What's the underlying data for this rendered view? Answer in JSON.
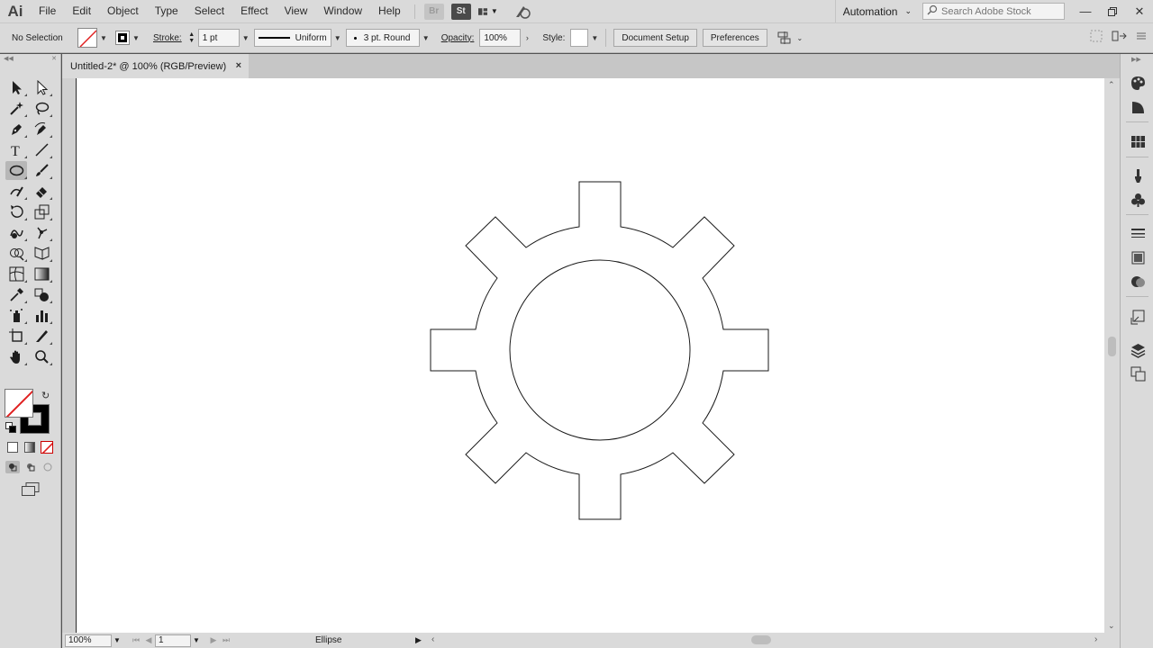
{
  "app": {
    "logo": "Ai",
    "menu": [
      "File",
      "Edit",
      "Object",
      "Type",
      "Select",
      "Effect",
      "View",
      "Window",
      "Help"
    ],
    "bridge_label": "Br",
    "stock_label": "St",
    "workspace": "Automation",
    "search_placeholder": "Search Adobe Stock"
  },
  "control_bar": {
    "selection": "No Selection",
    "stroke_label": "Stroke:",
    "stroke_weight": "1 pt",
    "stroke_profile": "Uniform",
    "brush": "3 pt. Round",
    "opacity_label": "Opacity:",
    "opacity": "100%",
    "style_label": "Style:",
    "document_setup": "Document Setup",
    "preferences": "Preferences"
  },
  "document": {
    "tab_title": "Untitled-2* @ 100% (RGB/Preview)",
    "close_glyph": "×"
  },
  "status_bar": {
    "zoom": "100%",
    "page": "1",
    "current_tool": "Ellipse"
  },
  "colors": {
    "chrome": "#dadada",
    "canvas": "#ffffff",
    "no_fill_slash": "#e02020",
    "stroke_default": "#000000"
  },
  "icons": {
    "toolbar": [
      "selection-tool-icon",
      "direct-selection-tool-icon",
      "magic-wand-icon",
      "lasso-icon",
      "pen-tool-icon",
      "curvature-tool-icon",
      "type-tool-icon",
      "line-segment-icon",
      "ellipse-tool-icon",
      "paintbrush-icon",
      "shaper-tool-icon",
      "eraser-icon",
      "rotate-tool-icon",
      "scale-tool-icon",
      "warp-tool-icon",
      "puppet-warp-icon",
      "shape-builder-icon",
      "perspective-grid-icon",
      "mesh-tool-icon",
      "gradient-tool-icon",
      "eyedropper-icon",
      "blend-tool-icon",
      "symbol-sprayer-icon",
      "column-graph-icon",
      "artboard-tool-icon",
      "slice-tool-icon",
      "hand-tool-icon",
      "zoom-tool-icon"
    ],
    "dock": [
      "color-guide-icon",
      "gradient-panel-icon",
      "swatches-icon",
      "brushes-icon",
      "symbols-icon",
      "stroke-panel-icon",
      "gradient-swatch-icon",
      "transparency-icon",
      "asset-export-icon",
      "layers-icon",
      "artboards-icon"
    ]
  }
}
